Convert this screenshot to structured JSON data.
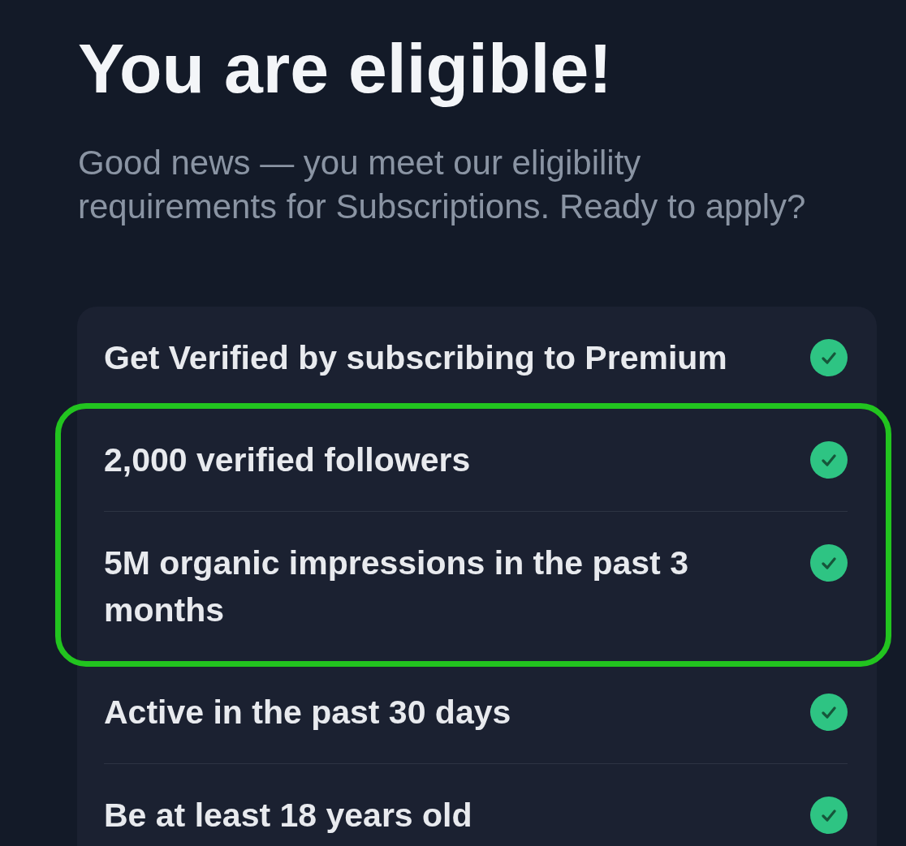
{
  "heading": "You are eligible!",
  "description": "Good news — you meet our eligibility requirements for Subscriptions. Ready to apply?",
  "requirements": [
    {
      "label": "Get Verified by subscribing to Premium",
      "met": true,
      "highlighted": false
    },
    {
      "label": "2,000 verified followers",
      "met": true,
      "highlighted": true
    },
    {
      "label": "5M organic impressions in the past 3 months",
      "met": true,
      "highlighted": true
    },
    {
      "label": "Active in the past 30 days",
      "met": true,
      "highlighted": false
    },
    {
      "label": "Be at least 18 years old",
      "met": true,
      "highlighted": false
    }
  ]
}
